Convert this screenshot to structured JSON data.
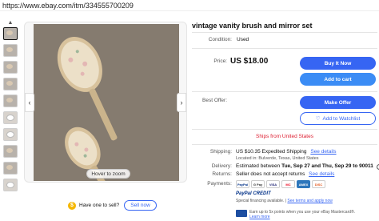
{
  "url": "https://www.ebay.com/itm/334555700209",
  "gallery": {
    "hover_zoom_label": "Hover to zoom",
    "thumbnail_count": 10
  },
  "sell": {
    "question": "Have one to sell?",
    "button": "Sell now"
  },
  "item": {
    "title": "vintage vanity brush and mirror set",
    "condition_label": "Condition:",
    "condition_value": "Used",
    "price_label": "Price:",
    "price_value": "US $18.00",
    "best_offer_label": "Best Offer:"
  },
  "buttons": {
    "buy_now": "Buy It Now",
    "add_to_cart": "Add to cart",
    "make_offer": "Make Offer",
    "watchlist": "Add to Watchlist"
  },
  "shipping": {
    "ships_from": "Ships from United States",
    "label": "Shipping:",
    "value": "US $10.35 Expedited Shipping",
    "see_details": "See details",
    "location": "Located in: Bulverde, Texas, United States"
  },
  "delivery": {
    "label": "Delivery:",
    "prefix": "Estimated between ",
    "dates": "Tue, Sep 27 and Thu, Sep 29 to 90011",
    "info_icon": "info-icon"
  },
  "returns": {
    "label": "Returns:",
    "value": "Seller does not accept returns",
    "see_details": "See details"
  },
  "payments": {
    "label": "Payments:",
    "logos": [
      "PayPal",
      "G Pay",
      "VISA",
      "MC",
      "AMEX",
      "DISC"
    ],
    "paypal_credit": "PayPal CREDIT",
    "financing": "Special financing available.",
    "financing_link": "See terms and apply now",
    "card_text": "Earn up to 5x points when you use your eBay Mastercard®.",
    "learn_more": "Learn more"
  },
  "colors": {
    "primary_blue": "#3665f3",
    "secondary_blue": "#3b8cf5",
    "alert_red": "#dd1e31"
  }
}
